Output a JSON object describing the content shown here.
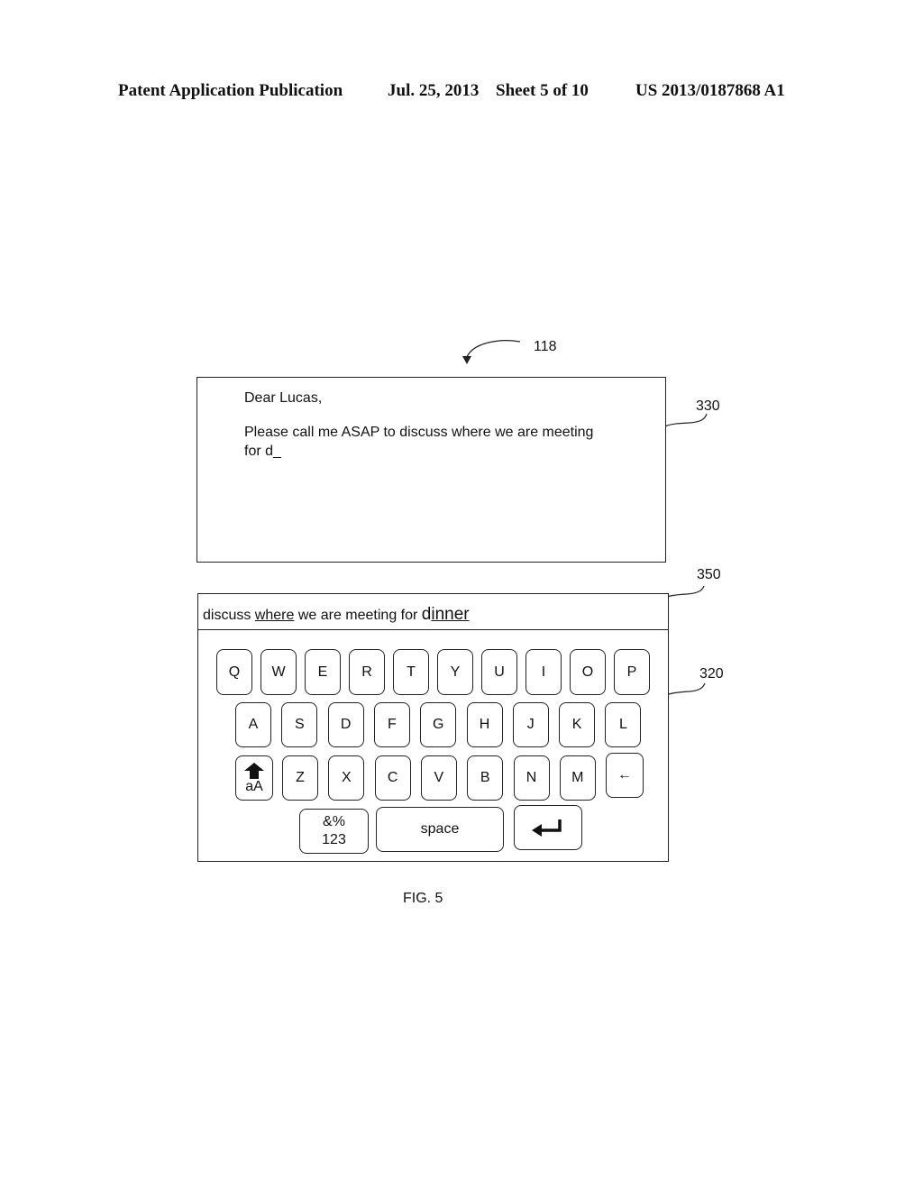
{
  "header": {
    "left": "Patent Application Publication",
    "date": "Jul. 25, 2013",
    "sheet": "Sheet 5 of 10",
    "number": "US 2013/0187868 A1"
  },
  "refs": {
    "device": "118",
    "text_area": "330",
    "suggestion_bar": "350",
    "keyboard": "320"
  },
  "message": {
    "line1": "Dear Lucas,",
    "line2": "Please call me ASAP to discuss where we are meeting",
    "line3": "for d_"
  },
  "suggestion": {
    "w1": "discuss ",
    "w2": "where",
    "w3": " we are meeting for ",
    "w4a": "d",
    "w4b": "inner"
  },
  "keyboard": {
    "row1": [
      "Q",
      "W",
      "E",
      "R",
      "T",
      "Y",
      "U",
      "I",
      "O",
      "P"
    ],
    "row2": [
      "A",
      "S",
      "D",
      "F",
      "G",
      "H",
      "J",
      "K",
      "L"
    ],
    "row3": [
      "Z",
      "X",
      "C",
      "V",
      "B",
      "N",
      "M"
    ],
    "shift_label": "aA",
    "backspace_symbol": "←",
    "symbols_label_top": "&%",
    "symbols_label_bottom": "123",
    "space_label": "space"
  },
  "caption": "FIG. 5"
}
